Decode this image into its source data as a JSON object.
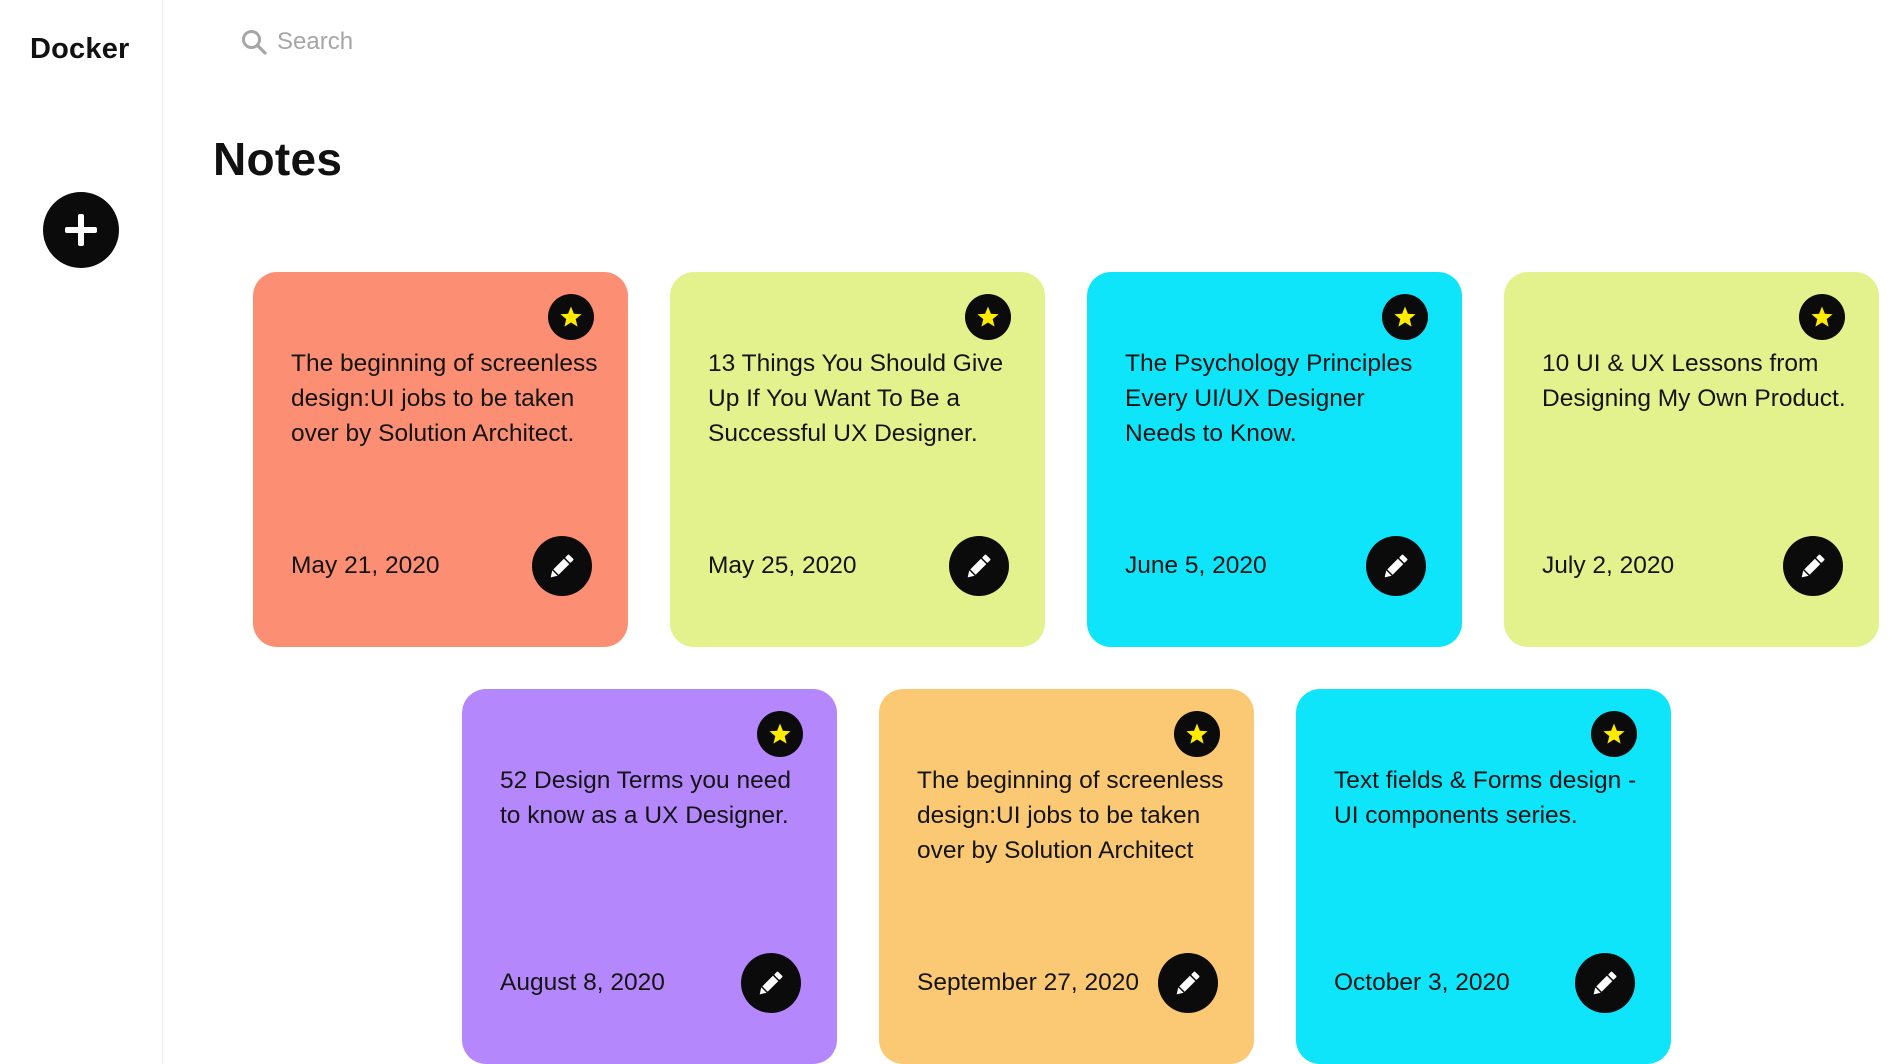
{
  "app": {
    "logo": "Docker"
  },
  "search": {
    "placeholder": "Search",
    "icon": "search-icon"
  },
  "sidebar": {
    "add_button_icon": "plus-icon"
  },
  "page": {
    "title": "Notes"
  },
  "colors": {
    "coral": "#FC8F73",
    "lime": "#E4F28D",
    "cyan": "#0EE5FA",
    "purple": "#B488FC",
    "orange": "#FBC973",
    "button": "#0B0B0B",
    "star": "#FFEB00"
  },
  "notes": [
    {
      "text": "The beginning of screenless design:UI jobs to be taken over by Solution Architect.",
      "date": "May 21, 2020",
      "color": "#FC8F73",
      "star_icon": "star-icon",
      "edit_icon": "pencil-icon"
    },
    {
      "text": "13 Things You Should Give Up If You Want To Be a Successful UX Designer.",
      "date": "May 25, 2020",
      "color": "#E4F28D",
      "star_icon": "star-icon",
      "edit_icon": "pencil-icon"
    },
    {
      "text": "The Psychology Principles Every UI/UX Designer Needs to Know.",
      "date": "June 5, 2020",
      "color": "#0EE5FA",
      "star_icon": "star-icon",
      "edit_icon": "pencil-icon"
    },
    {
      "text": "10 UI & UX Lessons from Designing My Own Product.",
      "date": "July 2, 2020",
      "color": "#E4F28D",
      "star_icon": "star-icon",
      "edit_icon": "pencil-icon"
    },
    {
      "text": "52 Design Terms you need to know as a UX Designer.",
      "date": "August 8, 2020",
      "color": "#B488FC",
      "star_icon": "star-icon",
      "edit_icon": "pencil-icon"
    },
    {
      "text": "The beginning of screenless design:UI jobs to be taken over by Solution Architect",
      "date": "September 27, 2020",
      "color": "#FBC973",
      "star_icon": "star-icon",
      "edit_icon": "pencil-icon"
    },
    {
      "text": "Text fields & Forms design - UI components series.",
      "date": "October 3, 2020",
      "color": "#0EE5FA",
      "star_icon": "star-icon",
      "edit_icon": "pencil-icon"
    }
  ]
}
